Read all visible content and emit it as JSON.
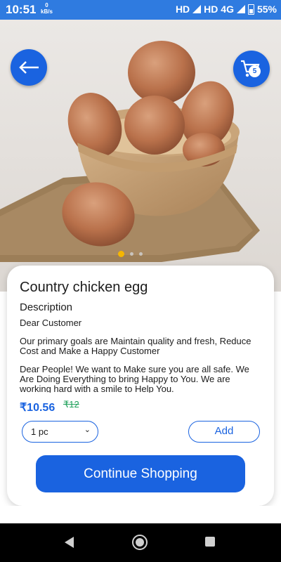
{
  "status_bar": {
    "time": "10:51",
    "speed_value": "0",
    "speed_unit": "kB/s",
    "network": "HD",
    "network2": "HD 4G",
    "battery": "55%"
  },
  "hero": {
    "cart_count": "5",
    "carousel_index": 0,
    "carousel_total": 3
  },
  "product": {
    "title": "Country chicken egg",
    "description_heading": "Description",
    "description_lines": [
      "Dear Customer",
      "Our primary goals are Maintain quality and fresh, Reduce Cost and Make a Happy Customer",
      "Dear People! We want to Make sure you are all safe. We Are Doing Everything to bring Happy to You. We are working hard with a smile to Help You."
    ],
    "price": "₹10.56",
    "mrp": "₹12",
    "quantity": "1 pc",
    "add_label": "Add",
    "continue_label": "Continue Shopping"
  },
  "colors": {
    "accent": "#1a63e0",
    "discount": "#1fa15b",
    "status_bar": "#2f7be0"
  }
}
